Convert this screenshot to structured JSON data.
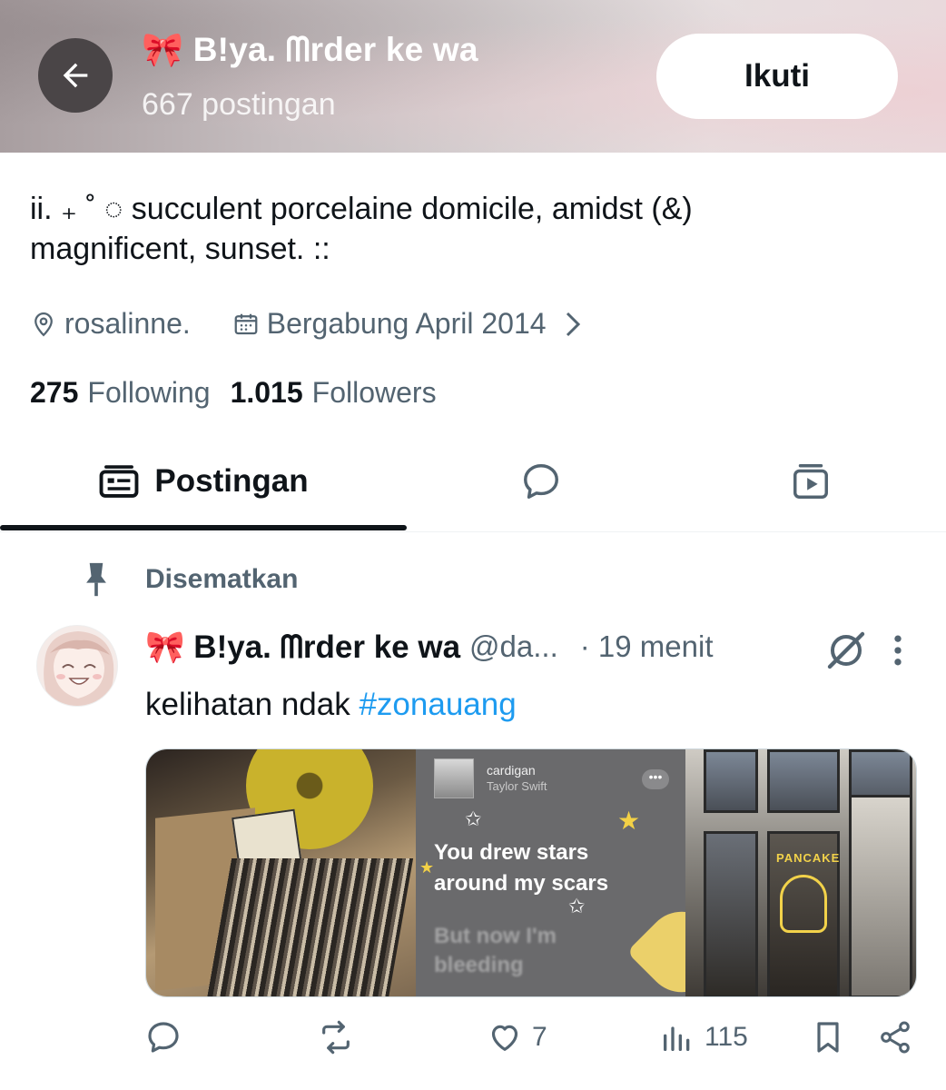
{
  "header": {
    "display_name": "🎀 B!ya. ᗰrder ke wa",
    "post_count": "667 postingan",
    "follow_label": "Ikuti"
  },
  "profile": {
    "bio_line1": "ii. ₊ ˚ ◌ succulent porcelaine domicile, amidst (&)",
    "bio_line2": "magnificent, sunset. ::",
    "location": "rosalinne.",
    "joined": "Bergabung April 2014",
    "following_count": "275",
    "following_label": "Following",
    "followers_count": "1.015",
    "followers_label": "Followers"
  },
  "tabs": [
    {
      "label": "Postingan",
      "icon": "posts-icon",
      "active": true
    },
    {
      "label": "",
      "icon": "replies-icon",
      "active": false
    },
    {
      "label": "",
      "icon": "media-icon",
      "active": false
    }
  ],
  "pinned_label": "Disematkan",
  "post": {
    "name": "🎀 B!ya. ᗰrder ke wa",
    "handle": "@da...",
    "time": "· 19 menit",
    "text": "kelihatan ndak ",
    "hashtag": "#zonauang",
    "media": {
      "song_title": "cardigan",
      "song_artist": "Taylor Swift",
      "lyric_1": "You drew stars",
      "lyric_2": "around my scars",
      "lyric_3": "But now I'm",
      "lyric_4": "bleeding",
      "sign_text": "PANCAKE"
    },
    "stats": {
      "likes": "7",
      "views": "115"
    }
  },
  "colors": {
    "accent": "#1d9bf0",
    "secondary_text": "#536471",
    "primary_text": "#0f1419"
  }
}
